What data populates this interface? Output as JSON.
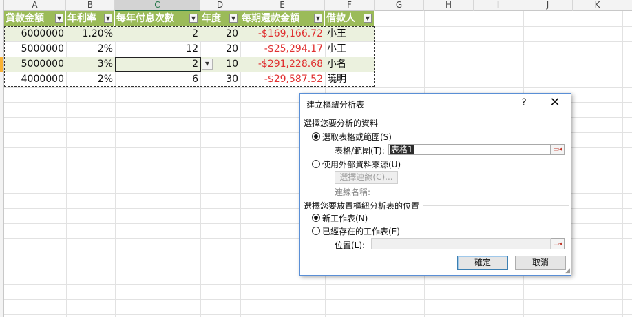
{
  "columns": [
    "A",
    "B",
    "C",
    "D",
    "E",
    "F",
    "G",
    "H",
    "I",
    "J",
    "K"
  ],
  "table": {
    "headers": [
      "貸款金額",
      "年利率",
      "每年付息次數",
      "年度",
      "每期還款金額",
      "借款人"
    ],
    "rows": [
      [
        "6000000",
        "1.20%",
        "2",
        "20",
        "-$169,166.72",
        "小王"
      ],
      [
        "5000000",
        "2%",
        "12",
        "20",
        "-$25,294.17",
        "小王"
      ],
      [
        "5000000",
        "3%",
        "2",
        "10",
        "-$291,228.68",
        "小名"
      ],
      [
        "4000000",
        "2%",
        "6",
        "30",
        "-$29,587.52",
        "曉明"
      ]
    ]
  },
  "colors": {
    "header_bg": "#9bbb59",
    "band": "#ebf1de",
    "negative": "#e03030",
    "dialog_border": "#5a8fd6"
  },
  "dialog": {
    "title": "建立樞紐分析表",
    "help": "?",
    "close": "✕",
    "section1": "選擇您要分析的資料",
    "opt_range": "選取表格或範圍(S)",
    "range_label": "表格/範圍(T):",
    "range_value": "表格1",
    "opt_external": "使用外部資料來源(U)",
    "choose_conn": "選擇連線(C)...",
    "conn_name_label": "連線名稱:",
    "section2": "選擇您要放置樞紐分析表的位置",
    "opt_new_sheet": "新工作表(N)",
    "opt_existing": "已經存在的工作表(E)",
    "location_label": "位置(L):",
    "location_value": "",
    "ok": "確定",
    "cancel": "取消"
  },
  "icons": {
    "filter": "filter-dropdown-icon",
    "ref": "range-select-icon"
  }
}
